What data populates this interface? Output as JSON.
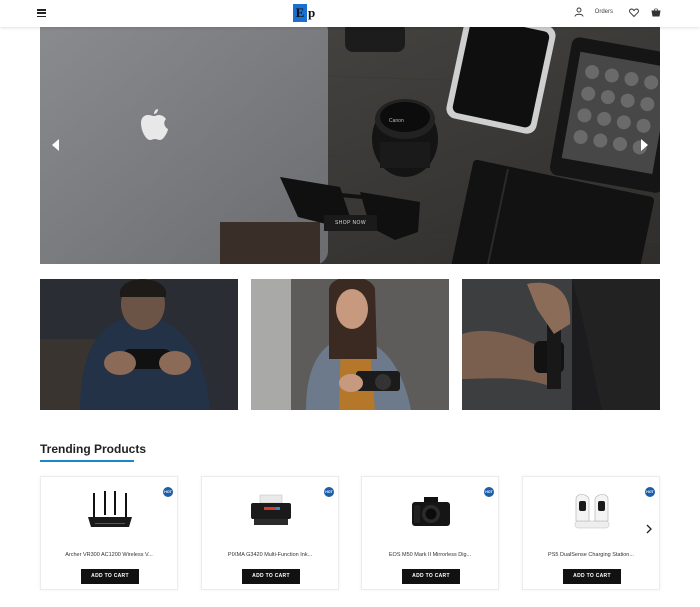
{
  "header": {
    "logo_letter": "E",
    "logo_rest": "p",
    "orders_label": "Orders",
    "icons": [
      "menu-icon",
      "user-icon",
      "heart-icon",
      "cart-icon"
    ]
  },
  "hero": {
    "button_label": "SHOP NOW",
    "icons": [
      "arrow-left-icon",
      "arrow-right-icon"
    ]
  },
  "categories": [
    {
      "name": "gaming"
    },
    {
      "name": "cameras"
    },
    {
      "name": "wearables"
    }
  ],
  "trending": {
    "title": "Trending Products",
    "accent_color": "#1b86c8",
    "products": [
      {
        "name": "Archer VR300 AC1200 Wireless V...",
        "badge": "HOT",
        "button": "ADD TO CART"
      },
      {
        "name": "PIXMA G3420 Multi-Function Ink...",
        "badge": "HOT",
        "button": "ADD TO CART"
      },
      {
        "name": "EOS M50 Mark II Mirrorless Dig...",
        "badge": "HOT",
        "button": "ADD TO CART"
      },
      {
        "name": "PS5 DualSense Charging Station...",
        "badge": "HOT",
        "button": "ADD TO CART"
      }
    ]
  }
}
